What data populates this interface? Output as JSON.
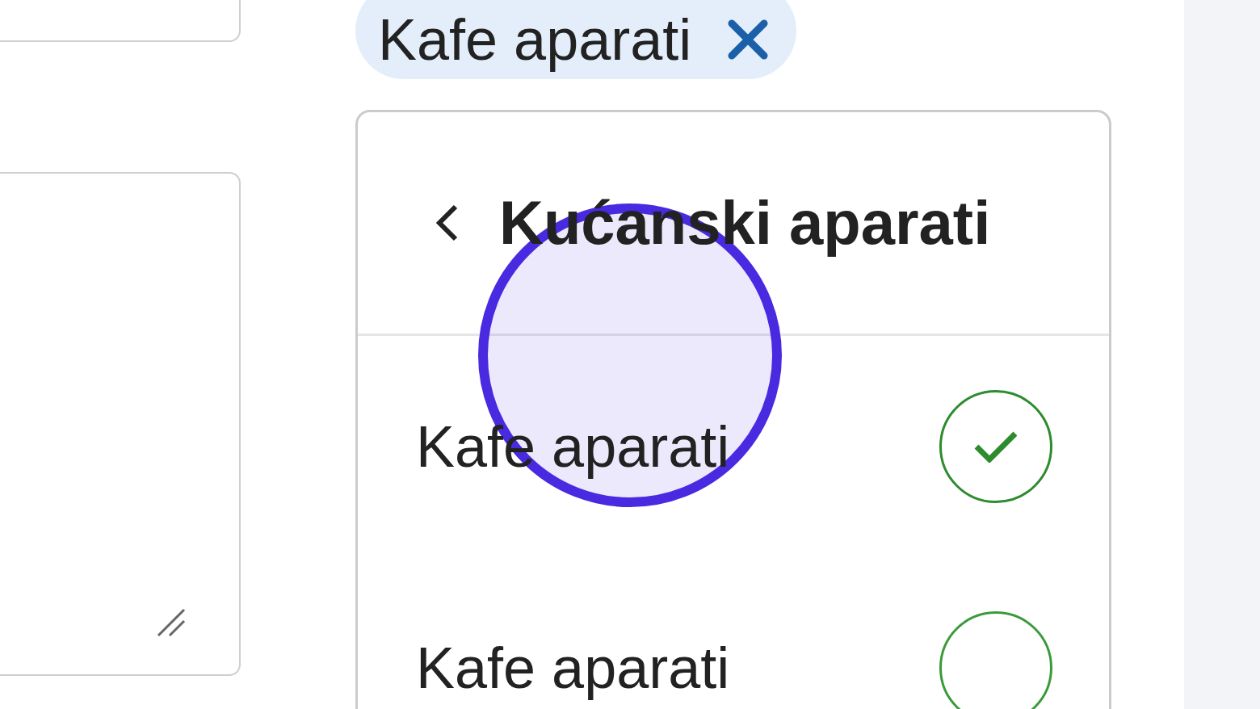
{
  "chip": {
    "label": "Kafe aparati"
  },
  "panel": {
    "title": "Kućanski aparati",
    "options": [
      {
        "label": "Kafe aparati",
        "selected": true
      },
      {
        "label": "Kafe aparati",
        "selected": false
      }
    ]
  }
}
